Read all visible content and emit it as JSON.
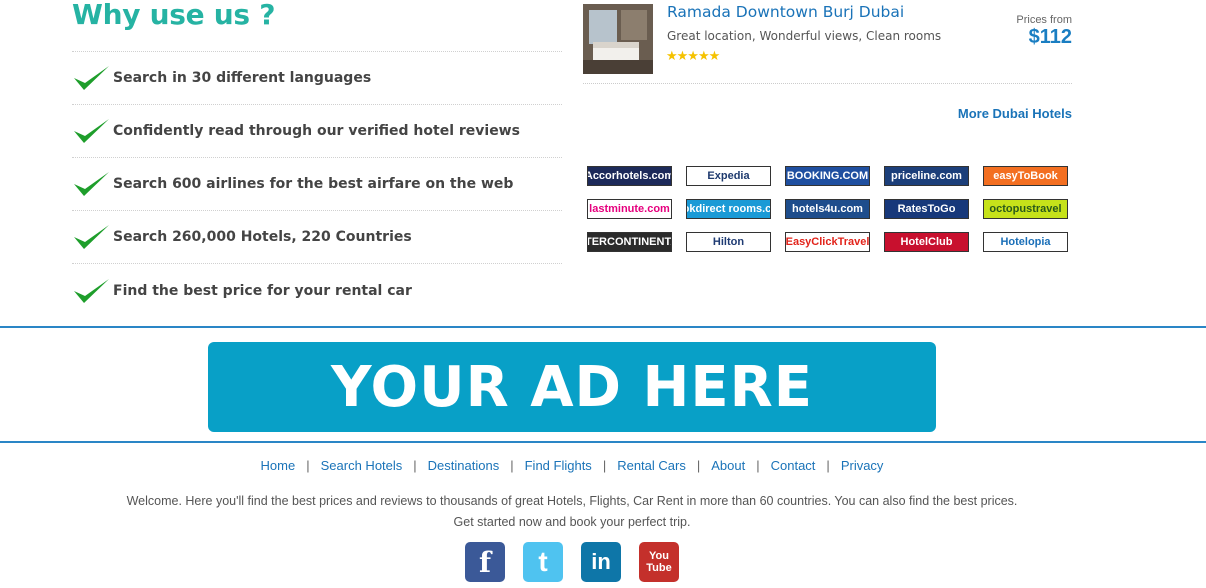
{
  "why": {
    "title": "Why use us ?",
    "items": [
      "Search in 30 different languages",
      "Confidently read through our verified hotel reviews",
      "Search 600 airlines for the best airfare on the web",
      "Search 260,000 Hotels, 220 Countries",
      "Find the best price for your rental car"
    ]
  },
  "hotel": {
    "name": "Ramada Downtown Burj Dubai",
    "description": "Great location, Wonderful views, Clean rooms",
    "stars": "★★★★★",
    "rating": 5,
    "price_label": "Prices from",
    "price": "$112"
  },
  "more_link": "More Dubai Hotels",
  "partners": [
    {
      "name": "Accorhotels.com",
      "bg": "#1d2a5a",
      "fg": "#ffffff"
    },
    {
      "name": "Expedia",
      "bg": "#ffffff",
      "fg": "#1e3a6e"
    },
    {
      "name": "BOOKING.COM",
      "bg": "#1f4fa0",
      "fg": "#ffffff"
    },
    {
      "name": "priceline.com",
      "bg": "#1c3f7a",
      "fg": "#ffffff"
    },
    {
      "name": "easyToBook",
      "bg": "#f36f21",
      "fg": "#ffffff"
    },
    {
      "name": "lastminute.com",
      "bg": "#ffffff",
      "fg": "#e6007e"
    },
    {
      "name": "bookdirect rooms.com",
      "bg": "#1a9ad6",
      "fg": "#ffffff"
    },
    {
      "name": "hotels4u.com",
      "bg": "#1e4d8c",
      "fg": "#ffffff"
    },
    {
      "name": "RatesToGo",
      "bg": "#17387a",
      "fg": "#ffffff"
    },
    {
      "name": "octopustravel",
      "bg": "#c6e21a",
      "fg": "#2a5a1a"
    },
    {
      "name": "INTERCONTINENTAL",
      "bg": "#2b2b2b",
      "fg": "#ffffff"
    },
    {
      "name": "Hilton",
      "bg": "#ffffff",
      "fg": "#1f3b73"
    },
    {
      "name": "EasyClickTravel",
      "bg": "#ffffff",
      "fg": "#e2231a"
    },
    {
      "name": "HotelClub",
      "bg": "#c8102e",
      "fg": "#ffffff"
    },
    {
      "name": "Hotelopia",
      "bg": "#ffffff",
      "fg": "#1a6fb8"
    }
  ],
  "ad": {
    "text": "YOUR AD HERE"
  },
  "footer": {
    "nav": [
      "Home",
      "Search Hotels",
      "Destinations",
      "Find Flights",
      "Rental Cars",
      "About",
      "Contact",
      "Privacy"
    ],
    "welcome_line1": "Welcome. Here you'll find the best prices and reviews to thousands of great Hotels, Flights, Car Rent in more than 60 countries. You can also find the best prices.",
    "welcome_line2": "Get started now and book your perfect trip."
  },
  "social": [
    {
      "icon": "facebook-icon",
      "glyph": "f",
      "bg": "#3b5998"
    },
    {
      "icon": "twitter-icon",
      "glyph": "t",
      "bg": "#4fc3f0"
    },
    {
      "icon": "linkedin-icon",
      "glyph": "in",
      "bg": "#0e76a8"
    },
    {
      "icon": "youtube-icon",
      "glyph": "You Tube",
      "bg": "#c4302b"
    }
  ],
  "colors": {
    "accent": "#26b3a3",
    "link": "#1a73b8",
    "ad": "#08a0c7",
    "divider": "#2a86c6"
  }
}
